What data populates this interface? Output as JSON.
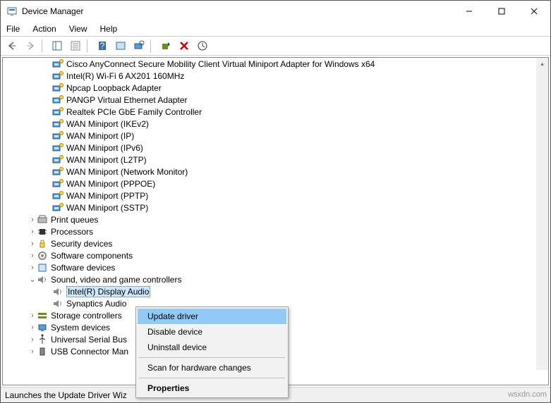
{
  "title": "Device Manager",
  "menubar": {
    "file": "File",
    "action": "Action",
    "view": "View",
    "help": "Help"
  },
  "network_devices": [
    "Cisco AnyConnect Secure Mobility Client Virtual Miniport Adapter for Windows x64",
    "Intel(R) Wi-Fi 6 AX201 160MHz",
    "Npcap Loopback Adapter",
    "PANGP Virtual Ethernet Adapter",
    "Realtek PCIe GbE Family Controller",
    "WAN Miniport (IKEv2)",
    "WAN Miniport (IP)",
    "WAN Miniport (IPv6)",
    "WAN Miniport (L2TP)",
    "WAN Miniport (Network Monitor)",
    "WAN Miniport (PPPOE)",
    "WAN Miniport (PPTP)",
    "WAN Miniport (SSTP)"
  ],
  "categories": {
    "print_queues": "Print queues",
    "processors": "Processors",
    "security_devices": "Security devices",
    "software_components": "Software components",
    "software_devices": "Software devices",
    "sound": "Sound, video and game controllers",
    "storage_controllers": "Storage controllers",
    "system_devices": "System devices",
    "usb_serial_bus": "Universal Serial Bus",
    "usb_connector_man": "USB Connector Man"
  },
  "sound_devices": {
    "intel_display_audio": "Intel(R) Display Audio",
    "synaptics_audio": "Synaptics Audio"
  },
  "context_menu": {
    "update_driver": "Update driver",
    "disable_device": "Disable device",
    "uninstall_device": "Uninstall device",
    "scan_hardware": "Scan for hardware changes",
    "properties": "Properties"
  },
  "status": "Launches the Update Driver Wiz",
  "watermark": "wsxdn.com"
}
